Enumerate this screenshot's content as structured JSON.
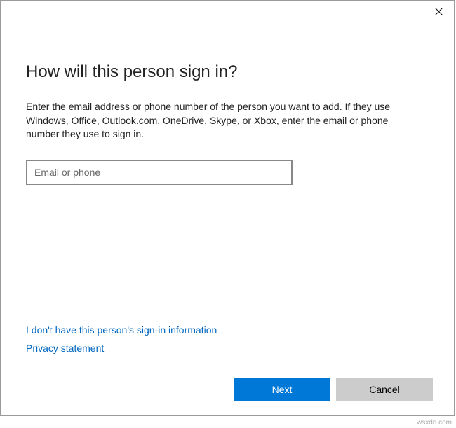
{
  "dialog": {
    "title": "How will this person sign in?",
    "description": "Enter the email address or phone number of the person you want to add. If they use Windows, Office, Outlook.com, OneDrive, Skype, or Xbox, enter the email or phone number they use to sign in.",
    "input": {
      "value": "",
      "placeholder": "Email or phone"
    },
    "links": {
      "no_signin_info": "I don't have this person's sign-in information",
      "privacy": "Privacy statement"
    },
    "buttons": {
      "next": "Next",
      "cancel": "Cancel"
    }
  },
  "watermark": "wsxdn.com"
}
